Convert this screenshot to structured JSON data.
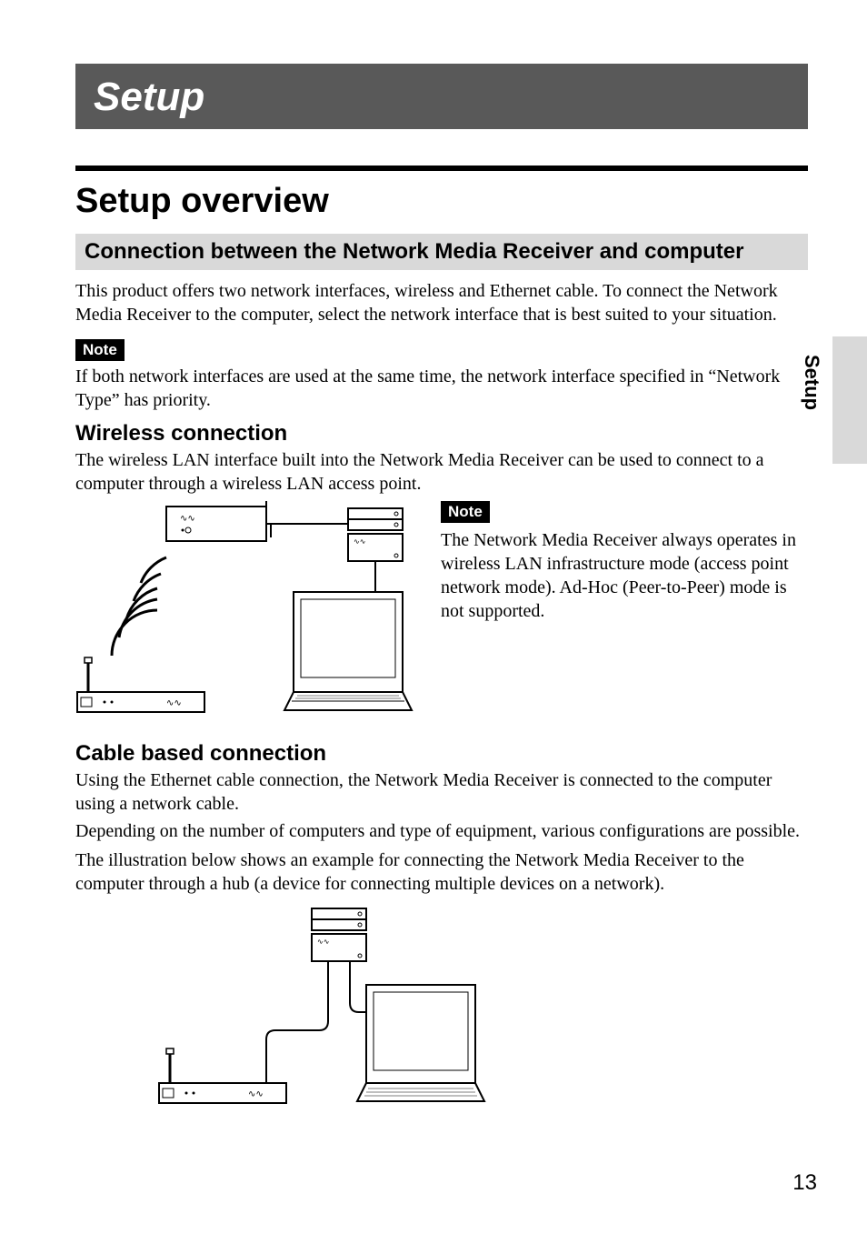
{
  "chapter_title": "Setup",
  "section_title": "Setup overview",
  "subsection_title": "Connection between the Network Media Receiver and computer",
  "intro_body": "This product offers two network interfaces, wireless and Ethernet cable. To connect the Network Media Receiver to the computer, select the network interface that is best suited to your situation.",
  "note_label": "Note",
  "note1_body": "If both network interfaces are used at the same time, the network interface specified in “Network Type” has priority.",
  "wireless_heading": "Wireless connection",
  "wireless_body": "The wireless LAN interface built into the Network Media Receiver can be used to connect to a computer through a wireless LAN access point.",
  "note2_body": "The Network Media Receiver always operates in wireless LAN infrastructure mode (access point network mode). Ad-Hoc (Peer-to-Peer) mode is not supported.",
  "cable_heading": "Cable based connection",
  "cable_body_1": "Using the Ethernet cable connection, the Network Media Receiver is connected to the computer using a network cable.",
  "cable_body_2": "Depending on the number of computers and type of equipment, various configurations are possible.",
  "cable_body_3": "The illustration below shows an example for connecting the Network Media Receiver to the computer through a hub (a device for connecting multiple devices on a network).",
  "side_tab_label": "Setup",
  "page_number": "13"
}
